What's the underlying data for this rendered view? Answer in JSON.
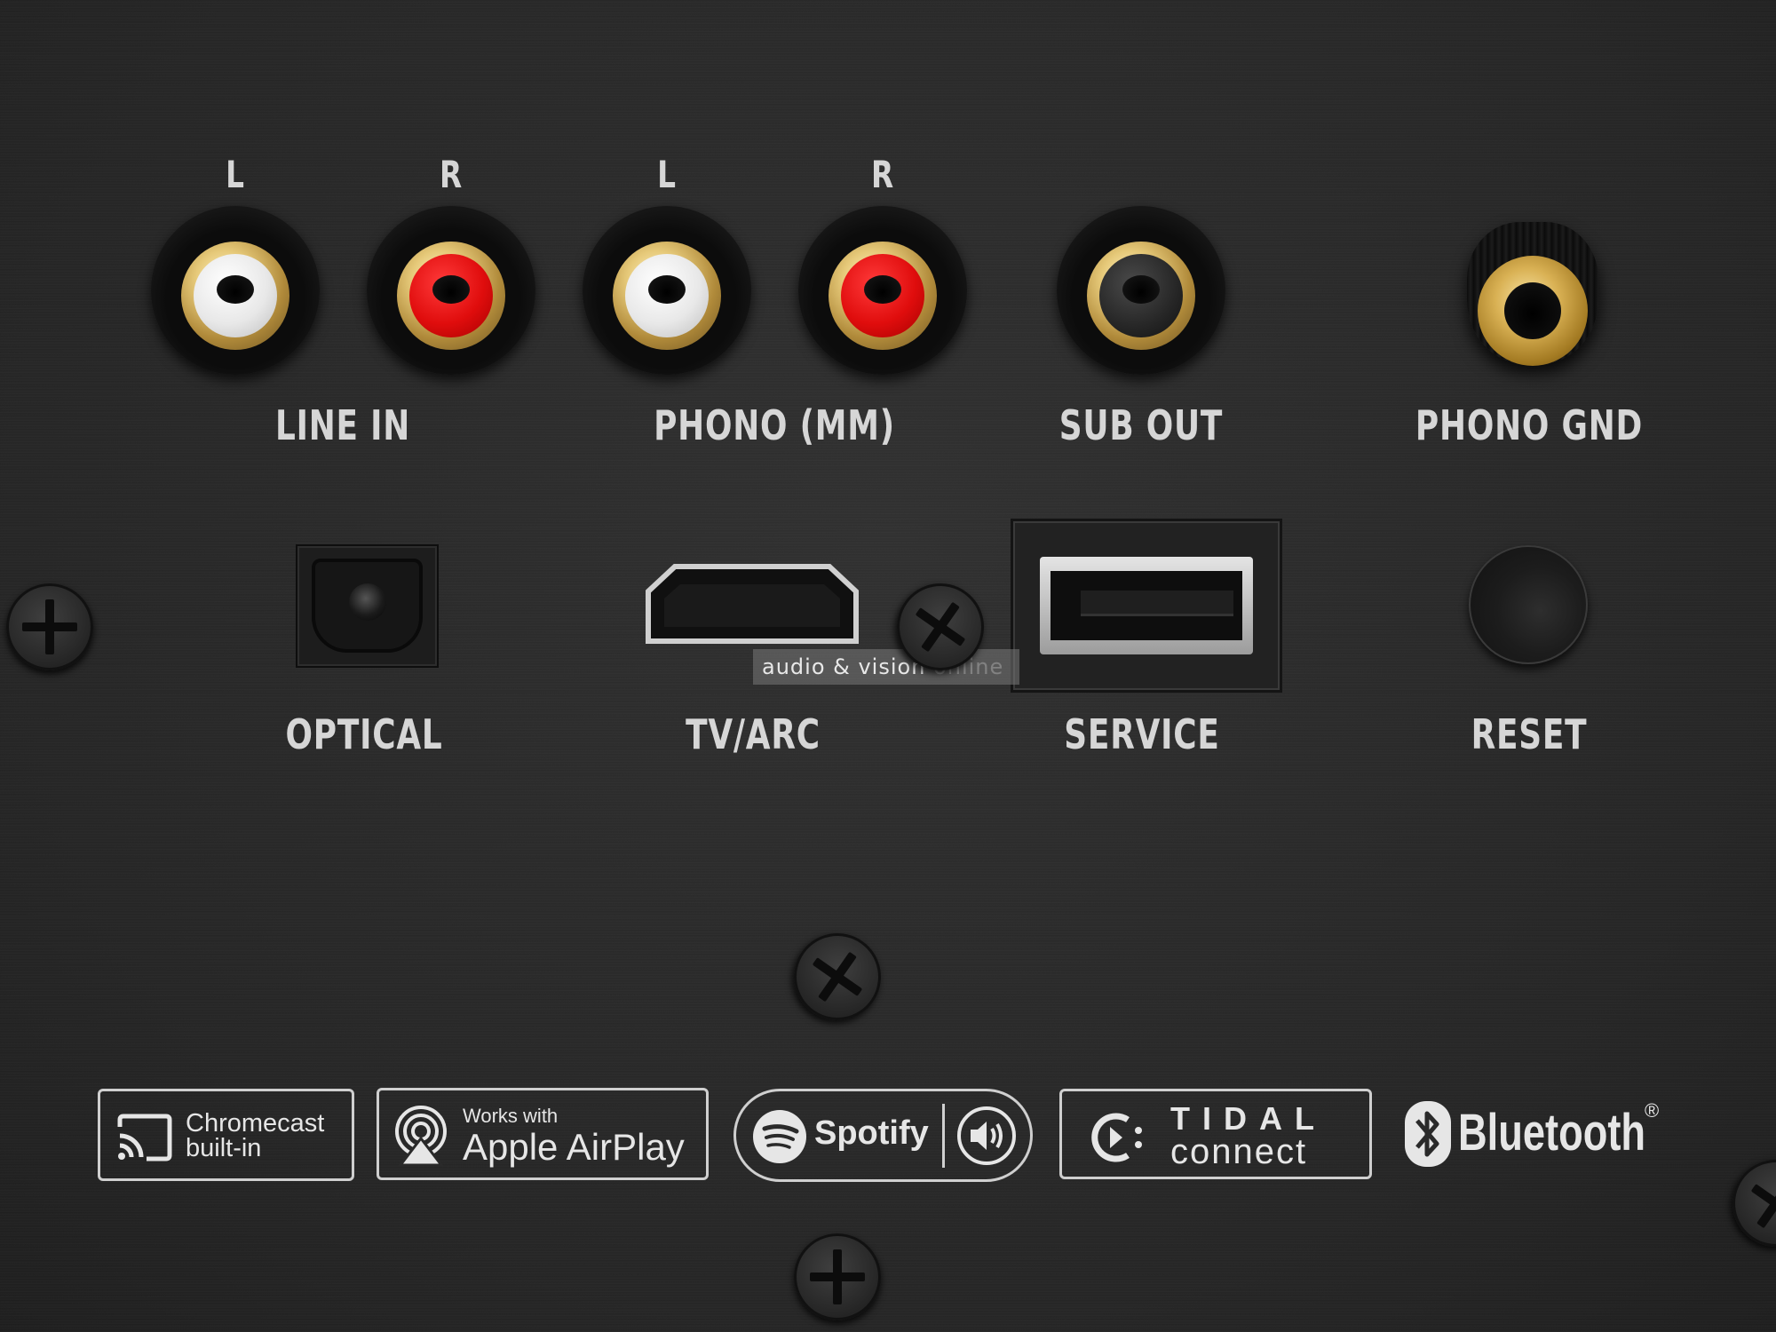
{
  "channels": {
    "line_in_left": "L",
    "line_in_right": "R",
    "phono_left": "L",
    "phono_right": "R"
  },
  "labels": {
    "line_in": "LINE IN",
    "phono_mm": "PHONO (MM)",
    "sub_out": "SUB OUT",
    "phono_gnd": "PHONO GND",
    "optical": "OPTICAL",
    "tv_arc": "TV/ARC",
    "service": "SERVICE",
    "reset": "RESET"
  },
  "watermark": {
    "main": "audio & vision",
    "faded": "online"
  },
  "logos": {
    "chromecast_line1": "Chromecast",
    "chromecast_line2": "built-in",
    "airplay_small": "Works with",
    "airplay_big": "Apple AirPlay",
    "spotify": "Spotify",
    "tidal_top": "TIDAL",
    "tidal_bottom": "connect",
    "bluetooth": "Bluetooth",
    "bluetooth_mark": "®"
  },
  "colors": {
    "panel": "#2a2a2a",
    "gold": "#d9b154",
    "rca_white": "#e8e8e8",
    "rca_red": "#e00d0d",
    "label_text": "#d6d6d6"
  }
}
